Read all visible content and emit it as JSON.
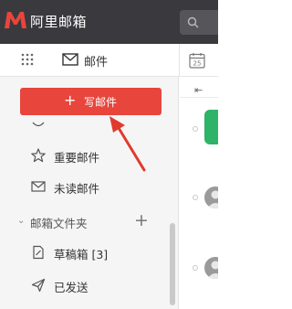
{
  "app": {
    "brand": "阿里邮箱"
  },
  "tabs": {
    "mail_label": "邮件",
    "calendar_day": "25"
  },
  "sidebar": {
    "compose_plus": "+",
    "compose_label": "写邮件",
    "items": [
      {
        "label": "重要邮件",
        "icon": "star-icon"
      },
      {
        "label": "未读邮件",
        "icon": "envelope-icon"
      }
    ],
    "folder_section": {
      "chevron": "⌄",
      "label": "邮箱文件夹",
      "add": "+"
    },
    "folders": [
      {
        "label": "草稿箱 [3]",
        "icon": "draft-icon"
      },
      {
        "label": "已发送",
        "icon": "send-icon"
      }
    ]
  },
  "list": {
    "toggle_glyph": "⇤"
  },
  "colors": {
    "topbar": "#3a3a3e",
    "brand_red": "#e8453c",
    "annotation_arrow": "#e03a2f",
    "avatar_green": "#2eb368"
  }
}
